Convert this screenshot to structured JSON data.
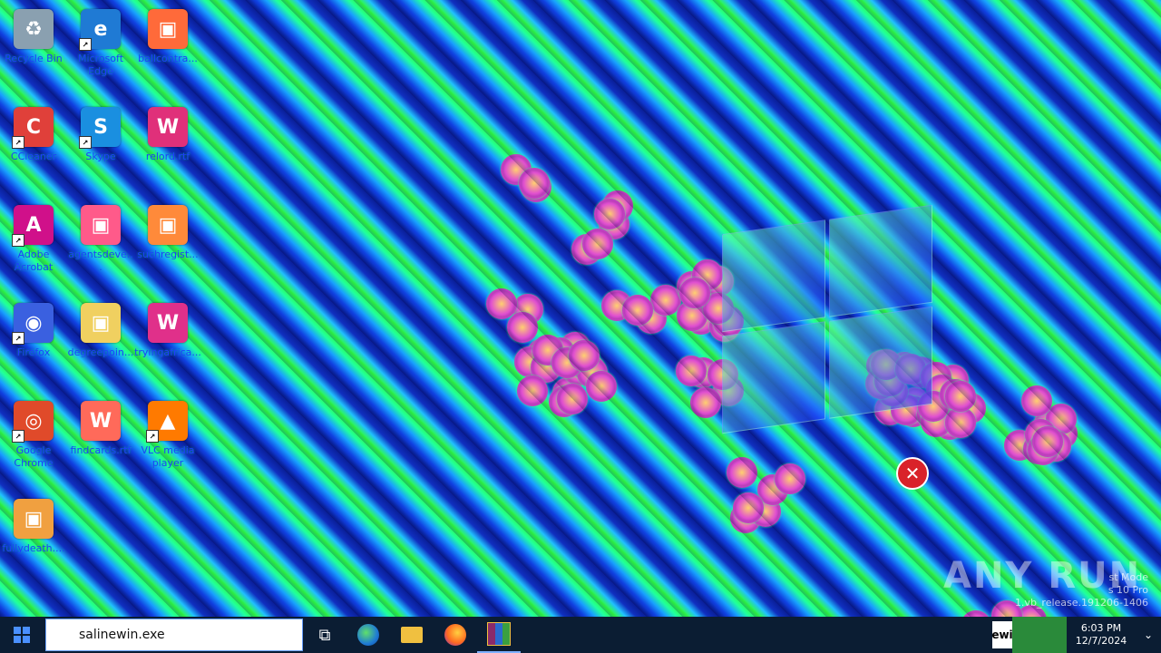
{
  "desktop": {
    "icons": [
      {
        "label": "Recycle Bin",
        "icon": "recycle-bin-icon",
        "color": "#8aa0b0",
        "glyph": "♻",
        "shortcut": false
      },
      {
        "label": "Microsoft Edge",
        "icon": "edge-icon",
        "color": "#1f7ad4",
        "glyph": "e",
        "shortcut": true
      },
      {
        "label": "ballcontra...",
        "icon": "image-file-icon",
        "color": "#ff6a3a",
        "glyph": "▣",
        "shortcut": false
      },
      {
        "label": "CCleaner",
        "icon": "ccleaner-icon",
        "color": "#e0403a",
        "glyph": "C",
        "shortcut": true
      },
      {
        "label": "Skype",
        "icon": "skype-icon",
        "color": "#1a8fe0",
        "glyph": "S",
        "shortcut": true
      },
      {
        "label": "relord.rtf",
        "icon": "rtf-file-icon",
        "color": "#e0307a",
        "glyph": "W",
        "shortcut": false
      },
      {
        "label": "Adobe Acrobat",
        "icon": "acrobat-icon",
        "color": "#d0108a",
        "glyph": "A",
        "shortcut": true
      },
      {
        "label": "agentsdeve...",
        "icon": "image-file-icon",
        "color": "#ff5a8a",
        "glyph": "▣",
        "shortcut": false
      },
      {
        "label": "suchregist...",
        "icon": "image-file-icon",
        "color": "#ff8a3a",
        "glyph": "▣",
        "shortcut": false
      },
      {
        "label": "Firefox",
        "icon": "firefox-icon",
        "color": "#3a60e0",
        "glyph": "◉",
        "shortcut": true
      },
      {
        "label": "degreepoin...",
        "icon": "image-file-icon",
        "color": "#f0d060",
        "glyph": "▣",
        "shortcut": false
      },
      {
        "label": "tryingafrica...",
        "icon": "rtf-file-icon",
        "color": "#e0308a",
        "glyph": "W",
        "shortcut": false
      },
      {
        "label": "Google Chrome",
        "icon": "chrome-icon",
        "color": "#e04a2a",
        "glyph": "◎",
        "shortcut": true
      },
      {
        "label": "findcards.rtf",
        "icon": "rtf-file-icon",
        "color": "#ff6a5a",
        "glyph": "W",
        "shortcut": false
      },
      {
        "label": "VLC media player",
        "icon": "vlc-icon",
        "color": "#ff7a00",
        "glyph": "▲",
        "shortcut": true
      },
      {
        "label": "fullydeath....",
        "icon": "image-file-icon",
        "color": "#f0a040",
        "glyph": "▣",
        "shortcut": false
      }
    ]
  },
  "watermark": {
    "text": "ANY RUN"
  },
  "winver": {
    "line1": "st Mode",
    "line2": "s 10 Pro",
    "line3": "1.vb_release.191206-1406"
  },
  "taskbar": {
    "search_value": "salinewin.exe",
    "task_view_glyph": "⧉",
    "tray_tip": "ewi",
    "clock_time": "6:03 PM",
    "clock_date": "12/7/2024",
    "chevron": "⌄"
  }
}
